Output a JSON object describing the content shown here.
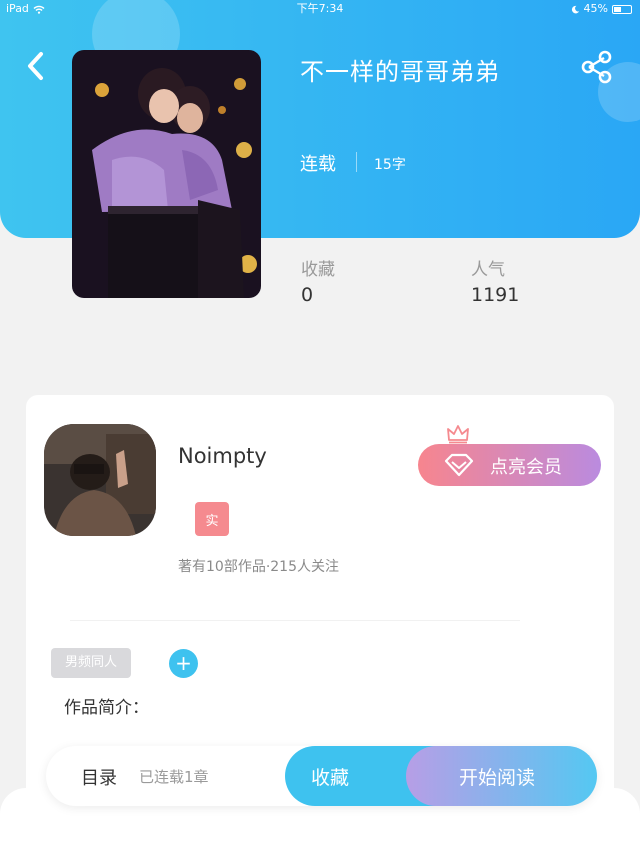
{
  "status_bar": {
    "device": "iPad",
    "time": "下午7:34",
    "battery": "45%"
  },
  "book": {
    "title": "不一样的哥哥弟弟",
    "status": "连载",
    "word_count": "15字"
  },
  "stats": {
    "favorites_label": "收藏",
    "favorites_value": "0",
    "popularity_label": "人气",
    "popularity_value": "1191"
  },
  "author": {
    "name": "Noimpty",
    "badge": "实",
    "summary": "著有10部作品·215人关注"
  },
  "vip_button": {
    "label": "点亮会员"
  },
  "tags": [
    "男频同人"
  ],
  "intro_label": "作品简介：",
  "bottom_bar": {
    "toc_label": "目录",
    "toc_status": "已连载1章",
    "favorite_label": "收藏",
    "read_label": "开始阅读"
  },
  "colors": {
    "header_start": "#3fc4f0",
    "header_end": "#2aa7f5",
    "accent_blue": "#3ec2ef",
    "vip_start": "#f7858e",
    "vip_end": "#ba8bdf"
  },
  "icons": [
    "back-chevron-icon",
    "share-icon",
    "crown-icon",
    "diamond-icon",
    "plus-icon",
    "wifi-icon",
    "battery-icon"
  ]
}
